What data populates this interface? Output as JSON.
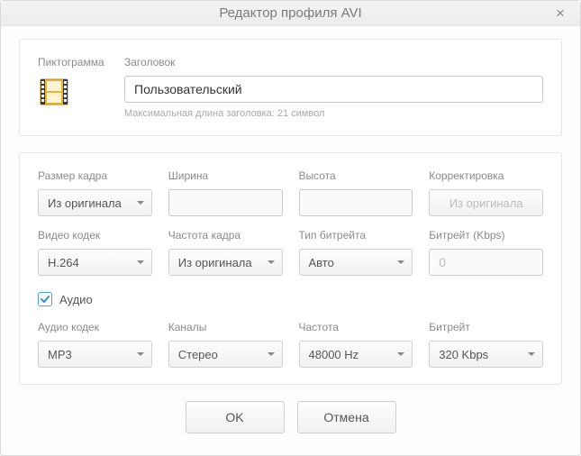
{
  "window": {
    "title": "Редактор профиля AVI"
  },
  "header": {
    "pictogram_label": "Пиктограмма",
    "title_label": "Заголовок",
    "title_value": "Пользовательский",
    "hint": "Максимальная длина заголовка: 21 символ"
  },
  "video": {
    "frame_size": {
      "label": "Размер кадра",
      "value": "Из оригинала"
    },
    "width": {
      "label": "Ширина",
      "value": ""
    },
    "height": {
      "label": "Высота",
      "value": ""
    },
    "adjustment": {
      "label": "Корректировка",
      "value": "Из оригинала"
    },
    "codec": {
      "label": "Видео кодек",
      "value": "H.264"
    },
    "framerate": {
      "label": "Частота кадра",
      "value": "Из оригинала"
    },
    "bitrate_type": {
      "label": "Тип битрейта",
      "value": "Авто"
    },
    "bitrate": {
      "label": "Битрейт (Kbps)",
      "value": "0"
    }
  },
  "audio": {
    "enabled_label": "Аудио",
    "enabled": true,
    "codec": {
      "label": "Аудио кодек",
      "value": "MP3"
    },
    "channels": {
      "label": "Каналы",
      "value": "Стерео"
    },
    "sample_rate": {
      "label": "Частота",
      "value": "48000 Hz"
    },
    "bitrate": {
      "label": "Битрейт",
      "value": "320 Kbps"
    }
  },
  "buttons": {
    "ok": "OK",
    "cancel": "Отмена"
  }
}
